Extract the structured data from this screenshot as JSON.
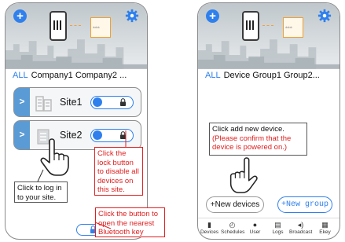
{
  "left_screen": {
    "tabs": {
      "all": "ALL",
      "rest": "Company1  Company2 ..."
    },
    "sites": [
      {
        "label": "Site1"
      },
      {
        "label": "Site2"
      }
    ],
    "callouts": {
      "lock_hint": "Click the lock button to disable all devices on this site.",
      "login_hint": "Click to log in to your site.",
      "bluetooth_hint": "Click the button to open the nearest Bluetooth key"
    }
  },
  "right_screen": {
    "tabs": {
      "all": "ALL",
      "rest": "Device Group1  Group2..."
    },
    "add_device_hint_line1": "Click add new device.",
    "add_device_hint_line2": "(Please confirm that the device is powered on.)",
    "new_devices_label": "+New devices",
    "new_group_label": "+New group",
    "nav": [
      {
        "label": "Devices",
        "icon": "devices-icon"
      },
      {
        "label": "Schedules",
        "icon": "schedules-icon"
      },
      {
        "label": "User",
        "icon": "user-icon"
      },
      {
        "label": "Logs",
        "icon": "logs-icon"
      },
      {
        "label": "Broadcast",
        "icon": "broadcast-icon"
      },
      {
        "label": "Ekey",
        "icon": "ekey-icon"
      }
    ]
  },
  "colors": {
    "accent": "#2f80ed",
    "hint_red": "#e02020",
    "chevron_blue": "#5b9bd5",
    "dashed_orange": "#f2a03a"
  }
}
